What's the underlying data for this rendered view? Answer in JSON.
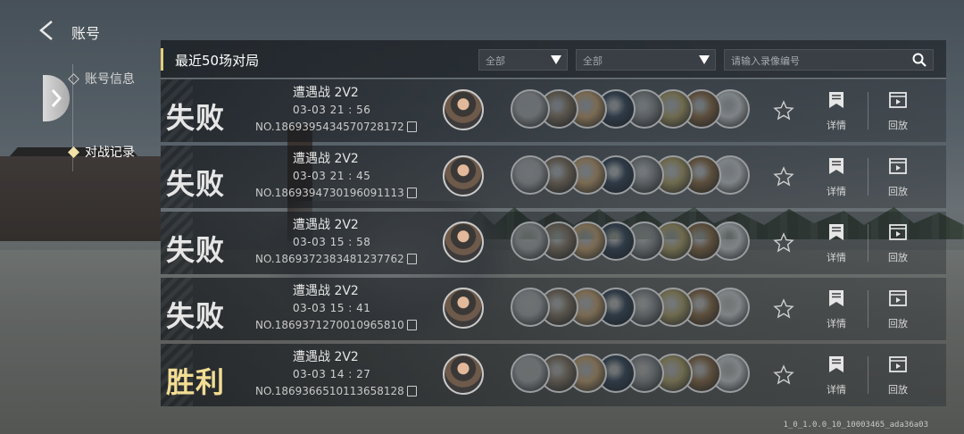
{
  "header": {
    "title": "账号"
  },
  "nav": {
    "items": [
      {
        "label": "账号信息",
        "active": false
      },
      {
        "label": "对战记录",
        "active": true
      }
    ]
  },
  "panel": {
    "title": "最近50场对局",
    "filter1": "全部",
    "filter2": "全部",
    "search_placeholder": "请输入录像编号"
  },
  "colors": {
    "accent": "#e3cd7c",
    "win": "#f2dd94"
  },
  "card_palette": [
    "#6a6e70",
    "#57524a",
    "#7a6a52",
    "#2e3a46",
    "#5a5f62",
    "#6e6a4e",
    "#5c4e3c",
    "#7e8386"
  ],
  "matches": [
    {
      "result": "失败",
      "win": false,
      "mode": "遭遇战 2V2",
      "time": "03-03  21 : 56",
      "record": "NO.1869395434570728172",
      "detail_label": "详情",
      "replay_label": "回放"
    },
    {
      "result": "失败",
      "win": false,
      "mode": "遭遇战 2V2",
      "time": "03-03  21 : 45",
      "record": "NO.1869394730196091113",
      "detail_label": "详情",
      "replay_label": "回放"
    },
    {
      "result": "失败",
      "win": false,
      "mode": "遭遇战 2V2",
      "time": "03-03  15 : 58",
      "record": "NO.1869372383481237762",
      "detail_label": "详情",
      "replay_label": "回放"
    },
    {
      "result": "失败",
      "win": false,
      "mode": "遭遇战 2V2",
      "time": "03-03  15 : 41",
      "record": "NO.1869371270010965810",
      "detail_label": "详情",
      "replay_label": "回放"
    },
    {
      "result": "胜利",
      "win": true,
      "mode": "遭遇战 2V2",
      "time": "03-03  14 : 27",
      "record": "NO.1869366510113658128",
      "detail_label": "详情",
      "replay_label": "回放"
    }
  ],
  "build": "1_0_1.0.0_10_10003465_ada36a03"
}
